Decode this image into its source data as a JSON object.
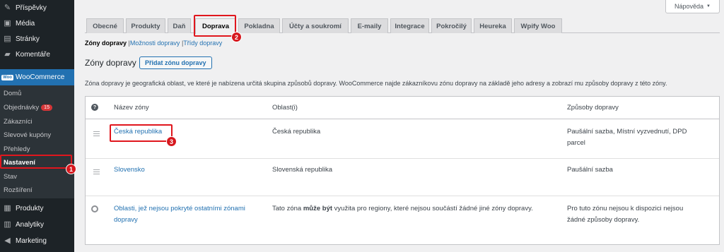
{
  "sidebar": {
    "menu": [
      {
        "label": "Příspěvky",
        "icon": "pin-icon"
      },
      {
        "label": "Média",
        "icon": "media-icon"
      },
      {
        "label": "Stránky",
        "icon": "pages-icon"
      },
      {
        "label": "Komentáře",
        "icon": "comments-icon"
      },
      {
        "label": "WooCommerce",
        "icon": "woocommerce-icon",
        "icon_text": "Woo"
      },
      {
        "label": "Produkty",
        "icon": "products-icon"
      },
      {
        "label": "Analytiky",
        "icon": "analytics-icon"
      },
      {
        "label": "Marketing",
        "icon": "marketing-icon"
      }
    ],
    "submenu": [
      {
        "label": "Domů"
      },
      {
        "label": "Objednávky",
        "badge": "15"
      },
      {
        "label": "Zákazníci"
      },
      {
        "label": "Slevové kupóny"
      },
      {
        "label": "Přehledy"
      },
      {
        "label": "Nastavení"
      },
      {
        "label": "Stav"
      },
      {
        "label": "Rozšíření"
      }
    ]
  },
  "help_button": {
    "label": "Nápověda",
    "arrow": "▼"
  },
  "tabs": [
    "Obecné",
    "Produkty",
    "Daň",
    "Doprava",
    "Pokladna",
    "Účty a soukromí",
    "E-maily",
    "Integrace",
    "Pokročilý",
    "Heureka",
    "Wpify Woo"
  ],
  "active_tab": "Doprava",
  "subnav": {
    "current": "Zóny dopravy",
    "links": [
      "Možnosti dopravy",
      "Třídy dopravy"
    ],
    "sep": "|"
  },
  "section": {
    "title": "Zóny dopravy",
    "add_button": "Přidat zónu dopravy",
    "description": "Zóna dopravy je geografická oblast, ve které je nabízena určitá skupina způsobů dopravy. WooCommerce najde zákazníkovu zónu dopravy na základě jeho adresy a zobrazí mu způsoby dopravy z této zóny."
  },
  "table": {
    "help_glyph": "?",
    "columns": [
      "Název zóny",
      "Oblast(i)",
      "Způsoby dopravy"
    ],
    "rows": [
      {
        "name": "Česká republika",
        "region": "Česká republika",
        "methods_line1": "Paušální sazba, Místní vyzvednutí, DPD",
        "methods_line2": "parcel"
      },
      {
        "name": "Slovensko",
        "region": "Slovenská republika",
        "methods_line1": "Paušální sazba",
        "methods_line2": ""
      }
    ],
    "rest": {
      "name_line1": "Oblasti, jež nejsou pokryté ostatními zónami",
      "name_line2": "dopravy",
      "region_before": "Tato zóna",
      "region_bold": "může být",
      "region_after": "využita pro regiony, které nejsou součástí žádné jiné zóny dopravy.",
      "methods_line1": "Pro tuto zónu nejsou k dispozici nejsou",
      "methods_line2": "žádné způsoby dopravy."
    }
  },
  "callouts": [
    "1",
    "2",
    "3"
  ],
  "colors": {
    "accent": "#2271b1",
    "sidebar": "#1d2327",
    "callout": "#e0161d"
  }
}
